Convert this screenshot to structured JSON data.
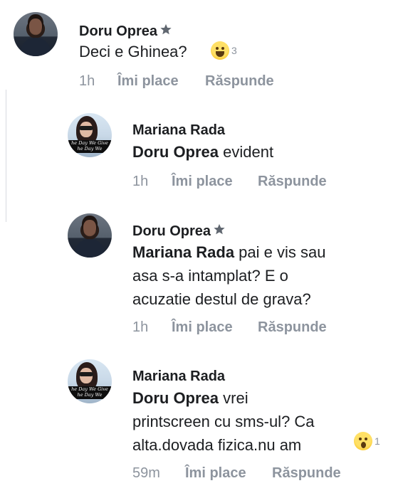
{
  "comments": [
    {
      "author": "Doru Oprea",
      "author_badge": "star-badge-icon",
      "text": "Deci e Ghinea?",
      "time": "1h",
      "like_label": "Îmi place",
      "reply_label": "Răspunde",
      "reaction": {
        "type": "laugh",
        "count": "3"
      }
    },
    {
      "author": "Mariana Rada",
      "avatar_caption_1": "he Day We Give",
      "avatar_caption_2": "he Day We",
      "mention": "Doru Oprea",
      "text_line_1": " evident",
      "time": "1h",
      "like_label": "Îmi place",
      "reply_label": "Răspunde"
    },
    {
      "author": "Doru Oprea",
      "author_badge": "star-badge-icon",
      "mention": "Mariana Rada",
      "text_line_1": " pai e vis sau",
      "text_line_2": "asa s-a intamplat? E o",
      "text_line_3": "acuzatie destul de grava?",
      "time": "1h",
      "like_label": "Îmi place",
      "reply_label": "Răspunde"
    },
    {
      "author": "Mariana Rada",
      "avatar_caption_1": "he Day We Give",
      "avatar_caption_2": "he Day We",
      "mention": "Doru Oprea",
      "text_line_1": " vrei",
      "text_line_2": "printscreen cu sms-ul? Ca",
      "text_line_3": "alta.dovada fizica.nu am",
      "time": "59m",
      "like_label": "Îmi place",
      "reply_label": "Răspunde",
      "reaction": {
        "type": "wow",
        "count": "1"
      }
    }
  ],
  "colors": {
    "text": "#1c1e21",
    "meta": "#8d949e",
    "badge": "#606770"
  }
}
